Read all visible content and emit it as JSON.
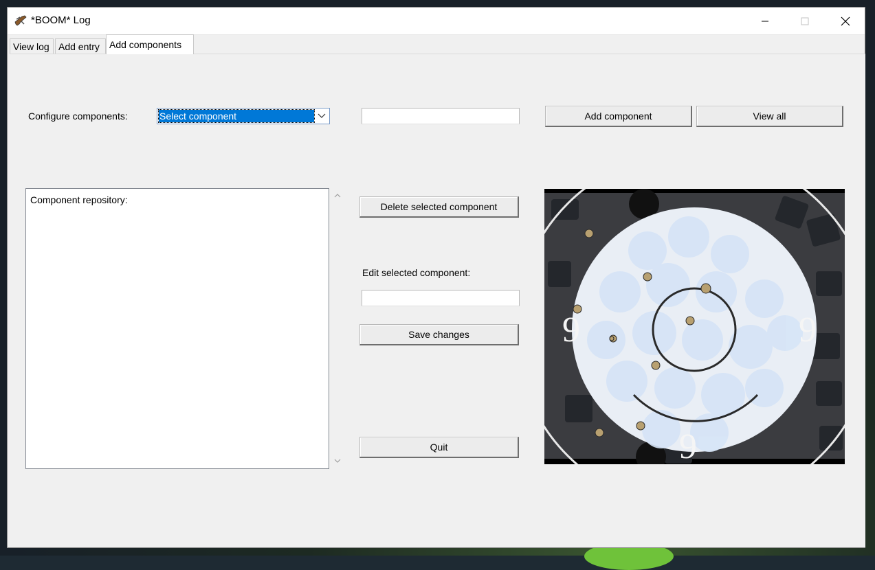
{
  "window": {
    "title": "*BOOM* Log",
    "icons": {
      "app": "rifle-icon",
      "minimize": "minimize-icon",
      "maximize": "maximize-icon",
      "close": "close-icon"
    }
  },
  "tabs": [
    {
      "label": "View log",
      "active": false
    },
    {
      "label": "Add entry",
      "active": false
    },
    {
      "label": "Add components",
      "active": true
    }
  ],
  "configure": {
    "label": "Configure components:",
    "select_value": "Select component",
    "new_component_value": "",
    "add_button": "Add component",
    "view_all_button": "View all"
  },
  "repository": {
    "label": "Component repository:"
  },
  "actions": {
    "delete_button": "Delete selected component",
    "edit_label": "Edit selected component:",
    "edit_value": "",
    "save_button": "Save changes",
    "quit_button": "Quit"
  },
  "target_image": {
    "ring_numbers": [
      "9",
      "9",
      "9"
    ]
  },
  "colors": {
    "selection": "#0078d7",
    "window_bg": "#f0f0f0",
    "title_bg": "#ffffff"
  }
}
